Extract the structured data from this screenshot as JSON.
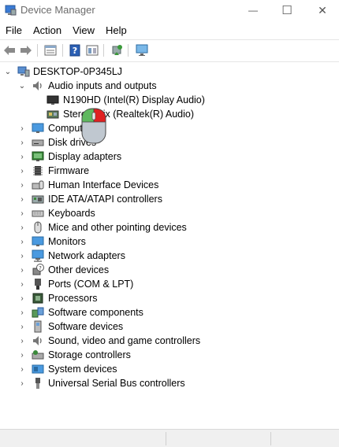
{
  "window": {
    "title": "Device Manager",
    "minimize_glyph": "—",
    "maximize_glyph": "☐",
    "close_glyph": "✕"
  },
  "menu": [
    "File",
    "Action",
    "View",
    "Help"
  ],
  "toolbar": {
    "buttons": [
      "back-arrow-icon",
      "forward-arrow-icon",
      "properties-icon",
      "help-icon",
      "view-icon",
      "update-driver-icon",
      "scan-hardware-icon"
    ]
  },
  "tree": {
    "root": "DESKTOP-0P345LJ",
    "expanded_category": "Audio inputs and outputs",
    "children": [
      "N190HD (Intel(R) Display Audio)",
      "Stereo Mix (Realtek(R) Audio)"
    ],
    "categories": [
      "Computer",
      "Disk drives",
      "Display adapters",
      "Firmware",
      "Human Interface Devices",
      "IDE ATA/ATAPI controllers",
      "Keyboards",
      "Mice and other pointing devices",
      "Monitors",
      "Network adapters",
      "Other devices",
      "Ports (COM & LPT)",
      "Processors",
      "Software components",
      "Software devices",
      "Sound, video and game controllers",
      "Storage controllers",
      "System devices",
      "Universal Serial Bus controllers"
    ]
  },
  "colors": {
    "accent": "#1e7bd0",
    "cursor_left": "#5fb85f",
    "cursor_right": "#e02020",
    "cursor_body": "#c0c8d0"
  }
}
